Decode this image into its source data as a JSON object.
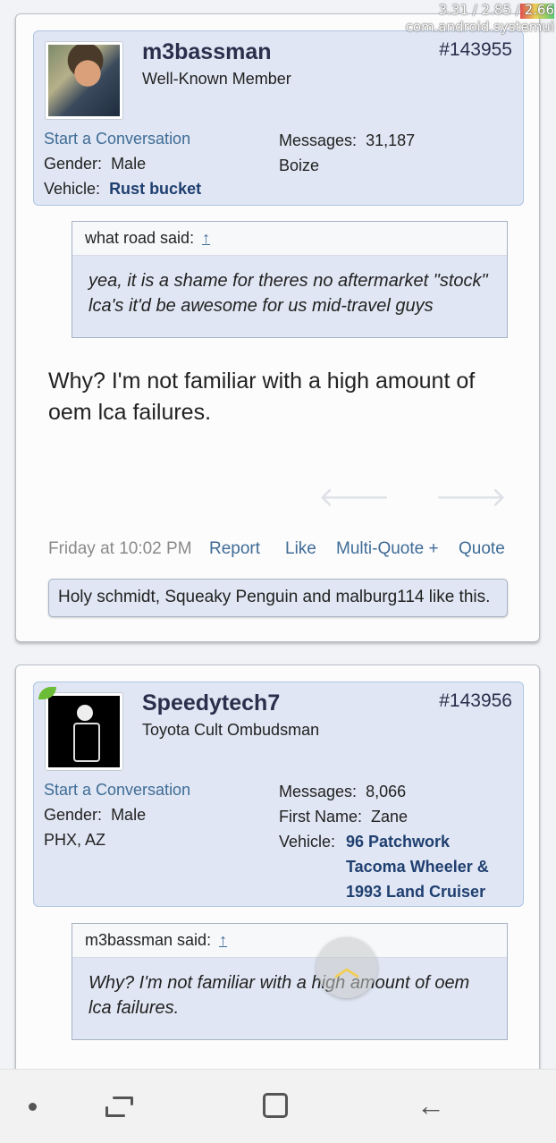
{
  "status_overlay": {
    "line1": "3.31 / 2.85 / 2.66",
    "line2": "com.android.systemui"
  },
  "posts": [
    {
      "username": "m3bassman",
      "user_title": "Well-Known Member",
      "post_number": "#143955",
      "start_conversation": "Start a Conversation",
      "gender_label": "Gender:",
      "gender_value": "Male",
      "vehicle_label": "Vehicle:",
      "vehicle_value": "Rust bucket",
      "messages_label": "Messages:",
      "messages_value": "31,187",
      "location": "Boize",
      "quote_author": "what road said:",
      "quote_arrow": "↑",
      "quote_text": "yea, it is a shame for theres no aftermarket \"stock\" lca's it'd be awesome for us mid-travel guys",
      "message": "Why? I'm not familiar with a high amount of oem lca failures.",
      "prev_icon": "arrow-left",
      "next_icon": "arrow-right",
      "date": "Friday at 10:02 PM",
      "actions": {
        "report": "Report",
        "like": "Like",
        "multiquote": "Multi-Quote +",
        "quote": "Quote"
      },
      "likes": {
        "user1": "Holy schmidt",
        "sep1": ", ",
        "user2": "Squeaky Penguin",
        "sep2": " and ",
        "user3": "malburg114",
        "suffix": " like this."
      }
    },
    {
      "username": "Speedytech7",
      "user_title": "Toyota Cult Ombudsman",
      "post_number": "#143956",
      "start_conversation": "Start a Conversation",
      "gender_label": "Gender:",
      "gender_value": "Male",
      "location": "PHX, AZ",
      "messages_label": "Messages:",
      "messages_value": "8,066",
      "firstname_label": "First Name:",
      "firstname_value": "Zane",
      "vehicle_label": "Vehicle:",
      "vehicle_line1": "96 Patchwork",
      "vehicle_line2": "Tacoma Wheeler &",
      "vehicle_line3": "1993 Land Cruiser",
      "quote_author": "m3bassman said:",
      "quote_arrow": "↑",
      "quote_text": "Why? I'm not familiar with a high amount of oem lca failures."
    }
  ],
  "scroll_top_icon": "chevron-up",
  "navbar": {
    "dot_icon": "dot",
    "recents_icon": "recents",
    "home_icon": "home",
    "back_icon": "back"
  },
  "colors": {
    "link": "#3f6c96",
    "username": "#2a2f4c",
    "userbox_bg": "#e0e6f3",
    "accent_green": "#6bbd37"
  }
}
